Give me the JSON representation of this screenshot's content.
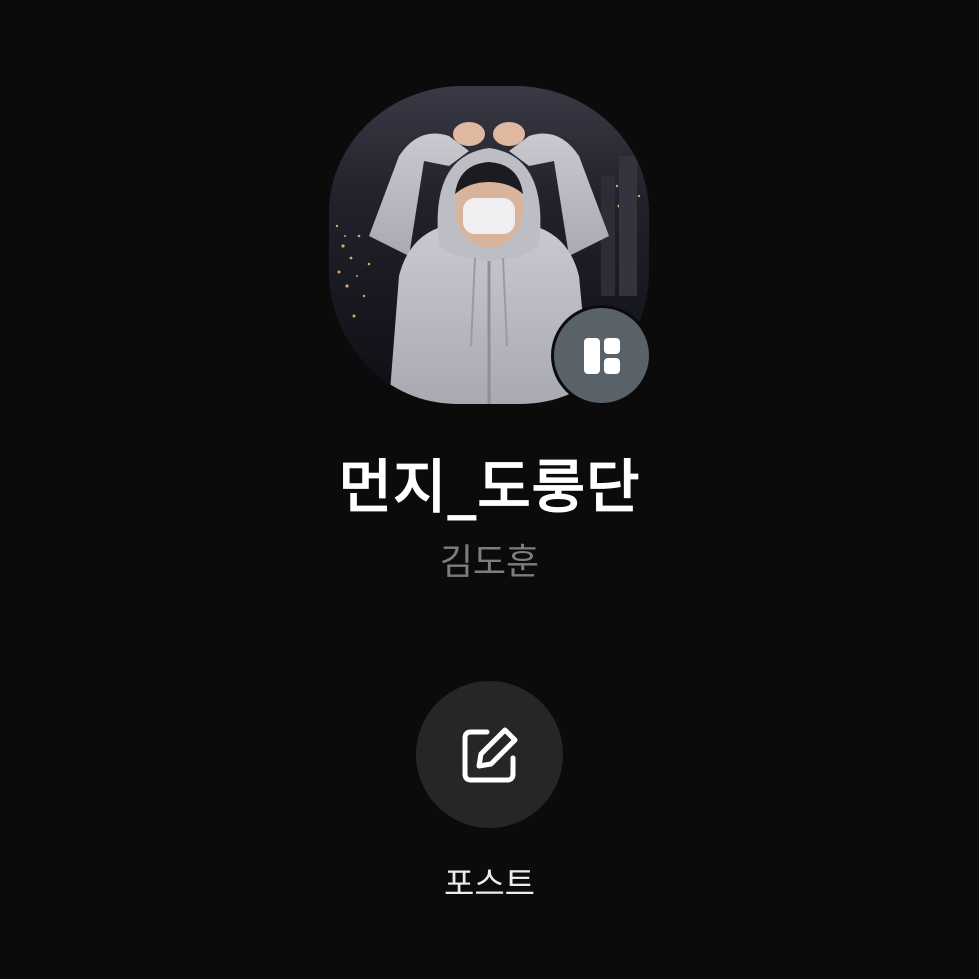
{
  "profile": {
    "display_name": "먼지_도룽단",
    "real_name": "김도훈",
    "avatar_description_icon": "profile-photo",
    "badge_icon": "layout-grid-icon"
  },
  "actions": {
    "post_label": "포스트",
    "post_icon": "edit-icon"
  },
  "colors": {
    "background": "#0b0b0c",
    "name_text": "#ffffff",
    "sub_text": "#7d7d7d",
    "action_circle": "#262627",
    "badge": "#596169"
  }
}
